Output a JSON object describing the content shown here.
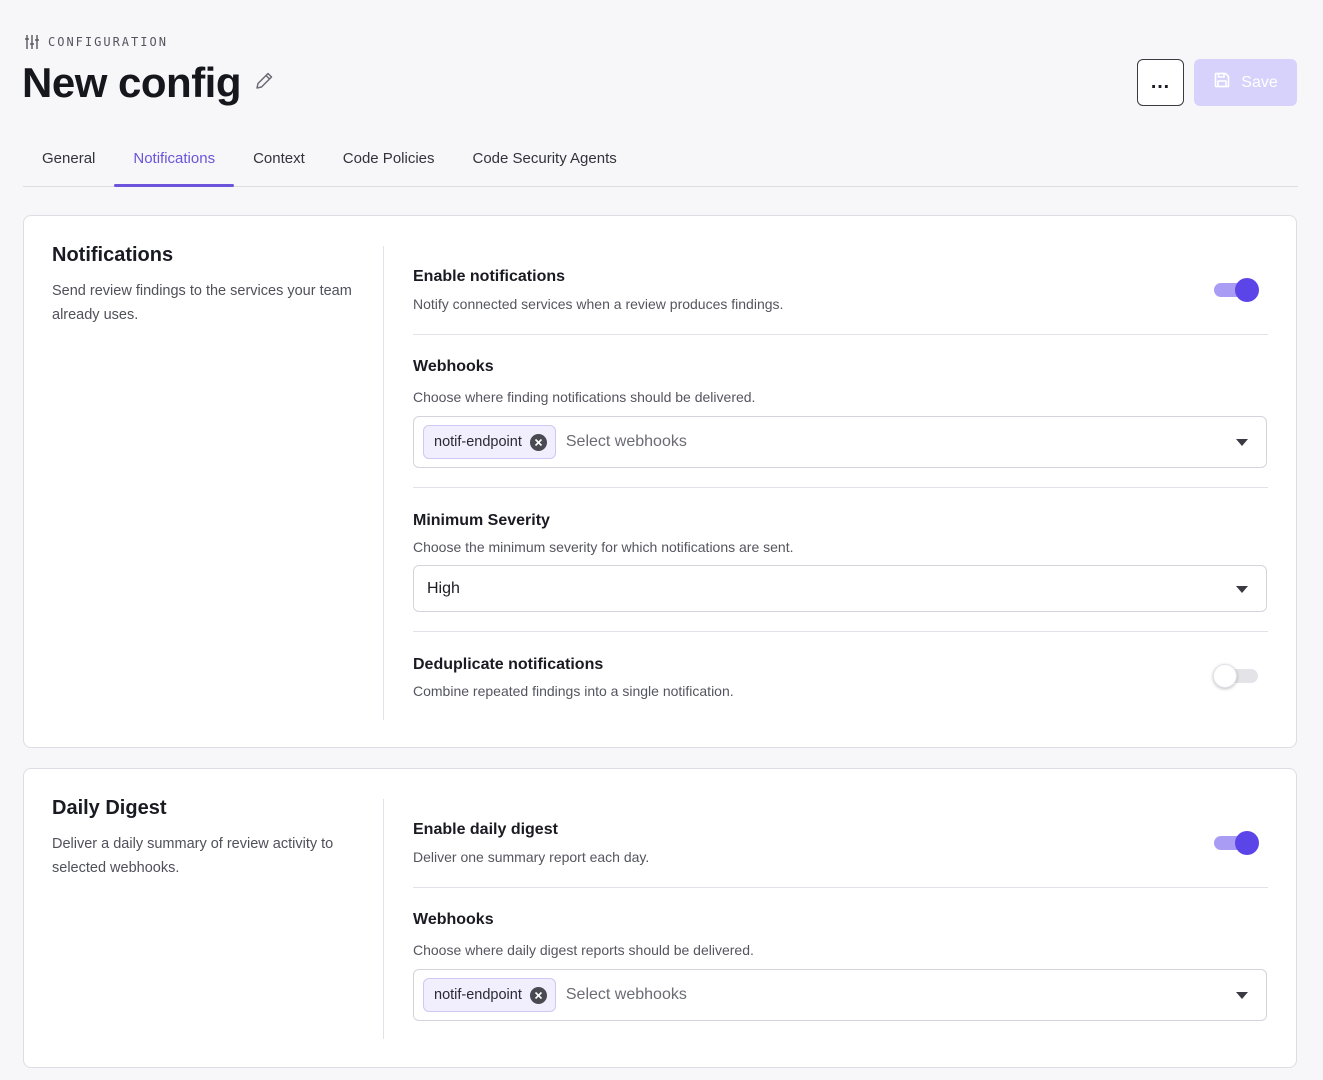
{
  "header": {
    "eyebrow": "CONFIGURATION",
    "title": "New config",
    "more_label": "…",
    "save_label": "Save"
  },
  "tabs": [
    {
      "label": "General",
      "active": false
    },
    {
      "label": "Notifications",
      "active": true
    },
    {
      "label": "Context",
      "active": false
    },
    {
      "label": "Code Policies",
      "active": false
    },
    {
      "label": "Code Security Agents",
      "active": false
    }
  ],
  "notifications": {
    "title": "Notifications",
    "description": "Send review findings to the services your team already uses.",
    "enable": {
      "label": "Enable notifications",
      "description": "Notify connected services when a review produces findings.",
      "on": true
    },
    "webhooks": {
      "label": "Webhooks",
      "description": "Choose where finding notifications should be delivered.",
      "chips": [
        "notif-endpoint"
      ],
      "placeholder": "Select webhooks"
    },
    "severity": {
      "label": "Minimum Severity",
      "description": "Choose the minimum severity for which notifications are sent.",
      "value": "High"
    },
    "dedupe": {
      "label": "Deduplicate notifications",
      "description": "Combine repeated findings into a single notification.",
      "on": false
    }
  },
  "digest": {
    "title": "Daily Digest",
    "description": "Deliver a daily summary of review activity to selected webhooks.",
    "enable": {
      "label": "Enable daily digest",
      "description": "Deliver one summary report each day.",
      "on": true
    },
    "webhooks": {
      "label": "Webhooks",
      "description": "Choose where daily digest reports should be delivered.",
      "chips": [
        "notif-endpoint"
      ],
      "placeholder": "Select webhooks"
    }
  },
  "colors": {
    "accent": "#6b54d9",
    "toggle_on": "#5b45e8",
    "save_disabled": "#d6d2fb"
  },
  "icons": {
    "eyebrow": "sliders-icon",
    "title_edit": "pencil-icon",
    "save": "floppy-disk-icon",
    "chip_remove": "close-circle-icon",
    "dropdown": "caret-down-icon"
  }
}
